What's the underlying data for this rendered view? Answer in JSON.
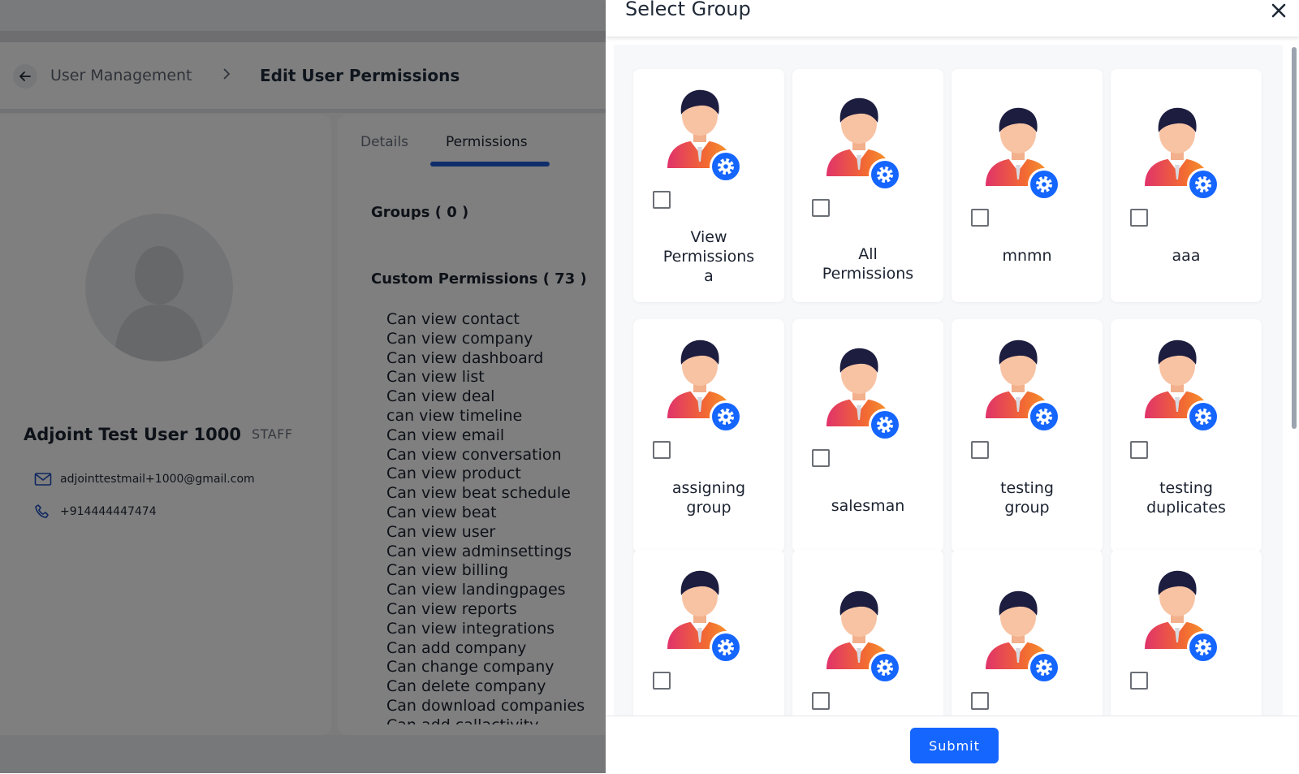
{
  "breadcrumb": {
    "parent": "User Management",
    "current": "Edit User Permissions"
  },
  "profile": {
    "name": "Adjoint Test User 1000",
    "role": "STAFF",
    "email": "adjointtestmail+1000@gmail.com",
    "phone": "+914444447474"
  },
  "tabs": {
    "details": "Details",
    "permissions": "Permissions"
  },
  "sections": {
    "groups": "Groups ( 0 )",
    "custom": "Custom Permissions ( 73 )"
  },
  "permissions": [
    "Can view contact",
    "Can view company",
    "Can view dashboard",
    "Can view list",
    "Can view deal",
    "can view timeline",
    "Can view email",
    "Can view conversation",
    "Can view product",
    "Can view beat schedule",
    "Can view beat",
    "Can view user",
    "Can view adminsettings",
    "Can view billing",
    "Can view landingpages",
    "Can view reports",
    "Can view integrations",
    "Can add company",
    "Can change company",
    "Can delete company",
    "Can download companies",
    "Can add callactivity"
  ],
  "drawer": {
    "title": "Select Group",
    "submit": "Submit",
    "groups": [
      {
        "lines": [
          "View",
          "Permissions",
          "a"
        ]
      },
      {
        "lines": [
          "All",
          "Permissions"
        ]
      },
      {
        "lines": [
          "mnmn"
        ]
      },
      {
        "lines": [
          "aaa"
        ]
      },
      {
        "lines": [
          "assigning",
          "group"
        ]
      },
      {
        "lines": [
          "salesman"
        ]
      },
      {
        "lines": [
          "testing",
          "group"
        ]
      },
      {
        "lines": [
          "testing",
          "duplicates"
        ]
      },
      {
        "lines": []
      },
      {
        "lines": []
      },
      {
        "lines": []
      },
      {
        "lines": []
      }
    ]
  },
  "colors": {
    "accent": "#1565ff",
    "tab_indicator": "#1e5bd6",
    "badge": "#1565ff"
  },
  "icons": [
    "back-arrow-icon",
    "chevron-right-icon",
    "user-silhouette-icon",
    "mail-icon",
    "phone-icon",
    "close-icon",
    "group-admin-icon",
    "gear-icon"
  ]
}
